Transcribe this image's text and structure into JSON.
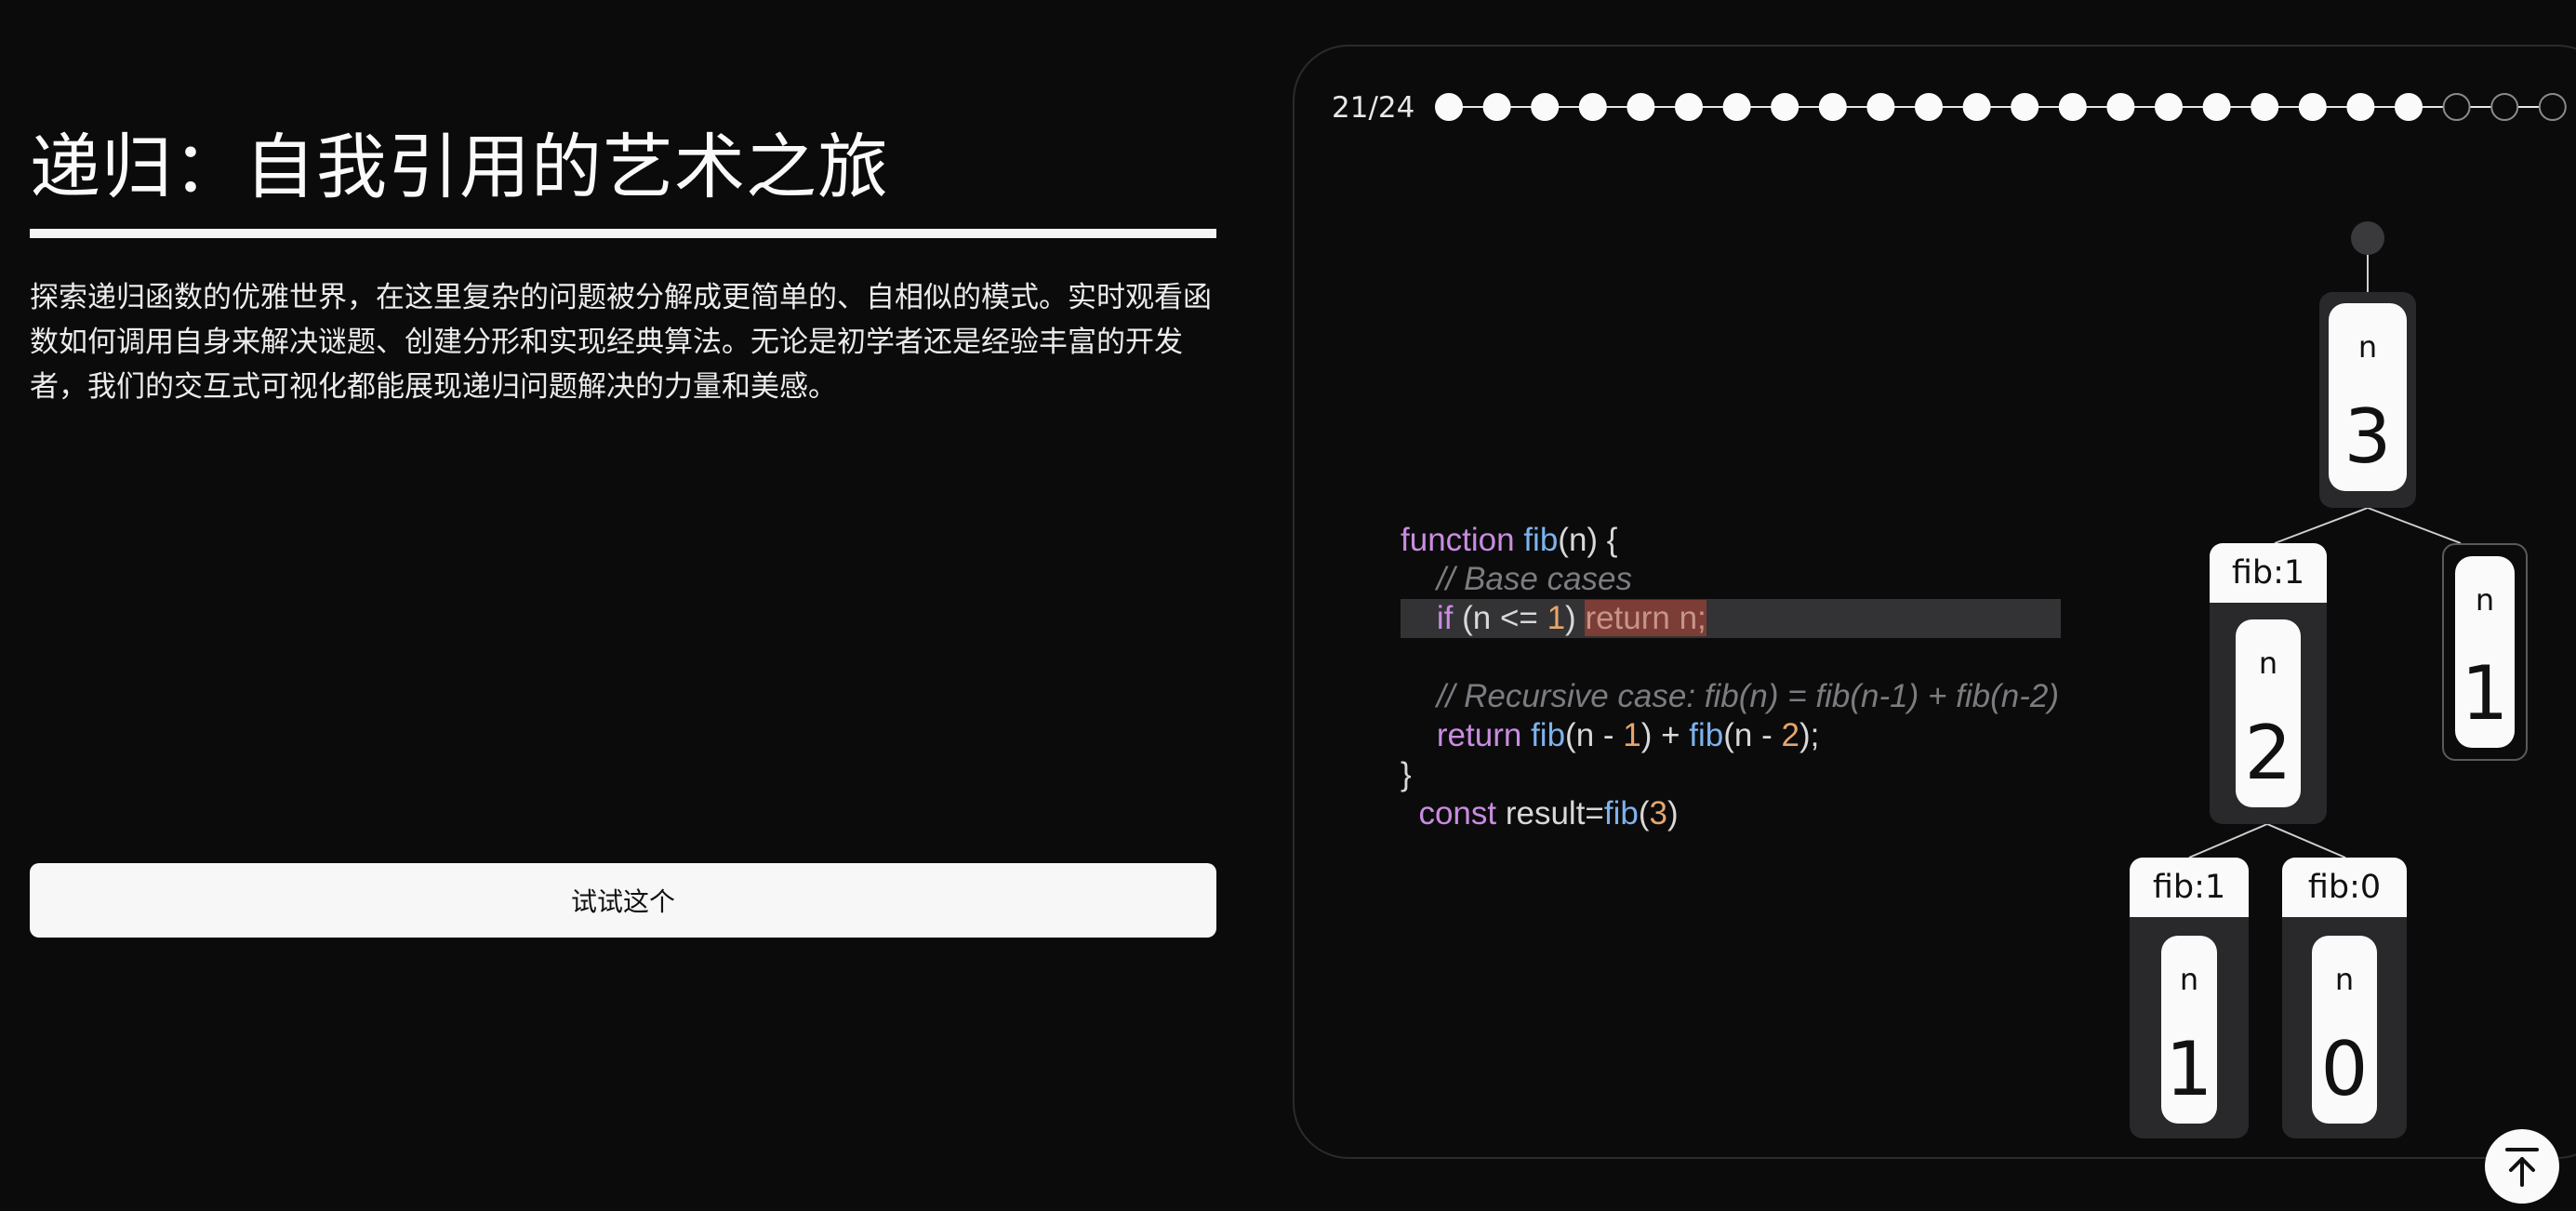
{
  "header": {
    "title": "递归：自我引用的艺术之旅",
    "description": "探索递归函数的优雅世界，在这里复杂的问题被分解成更简单的、自相似的模式。实时观看函数如何调用自身来解决谜题、创建分形和实现经典算法。无论是初学者还是经验丰富的开发者，我们的交互式可视化都能展现递归问题解决的力量和美感。",
    "try_button": "试试这个"
  },
  "progress": {
    "label": "21/24",
    "current": 21,
    "total": 24
  },
  "code": {
    "l1_kw": "function",
    "l1_fn": "fib",
    "l1_rest": "(n) {",
    "l2_comment": "// Base cases",
    "l3_kw": "if",
    "l3_a": " (n <= ",
    "l3_num": "1",
    "l3_b": ") ",
    "l3_ret": "return n;",
    "l4_comment": "// Recursive case: fib(n) = fib(n-1) + fib(n-2)",
    "l5_kw": "return",
    "l5_fn1": "fib",
    "l5_a": "(n - ",
    "l5_num1": "1",
    "l5_b": ") + ",
    "l5_fn2": "fib",
    "l5_c": "(n - ",
    "l5_num2": "2",
    "l5_d": ");",
    "l6": "}",
    "l7_kw": "const",
    "l7_a": " result=",
    "l7_fn": "fib",
    "l7_b": "(",
    "l7_num": "3",
    "l7_c": ")"
  },
  "tree": {
    "root": {
      "param": "n",
      "value": "3"
    },
    "left": {
      "label": "fib:1",
      "param": "n",
      "value": "2"
    },
    "right": {
      "param": "n",
      "value": "1"
    },
    "left_left": {
      "label": "fib:1",
      "param": "n",
      "value": "1"
    },
    "left_right": {
      "label": "fib:0",
      "param": "n",
      "value": "0"
    }
  },
  "icons": {
    "back_to_top": "arrow-up-to-line-icon"
  },
  "colors": {
    "background": "#0b0b0c",
    "keyword": "#c98ce0",
    "function": "#7db3ee",
    "number": "#e6a56e",
    "highlight": "#7b3d35"
  }
}
